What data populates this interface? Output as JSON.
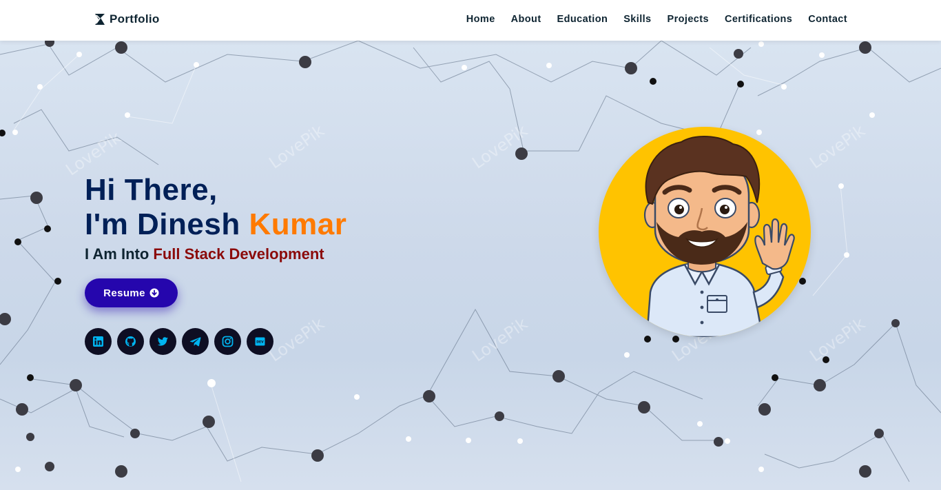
{
  "navbar": {
    "brand": "Portfolio",
    "links": [
      "Home",
      "About",
      "Education",
      "Skills",
      "Projects",
      "Certifications",
      "Contact"
    ]
  },
  "hero": {
    "greeting_line1": "Hi There,",
    "greeting_line2_prefix": "I'm Dinesh ",
    "greeting_line2_accent": "Kumar",
    "tagline_prefix": "I Am Into ",
    "tagline_role": "Full Stack Development",
    "resume_label": "Resume",
    "watermark": "LovePik",
    "socials": [
      {
        "name": "linkedin-icon"
      },
      {
        "name": "github-icon"
      },
      {
        "name": "twitter-icon"
      },
      {
        "name": "telegram-icon"
      },
      {
        "name": "instagram-icon"
      },
      {
        "name": "dev-icon",
        "label": "DEV"
      }
    ]
  },
  "colors": {
    "navy": "#002057",
    "accent_orange": "#ff7a00",
    "role_red": "#8b0a0a",
    "button_blue": "#2506ad",
    "social_bg": "#0e0e23",
    "social_icon": "#00b4f0",
    "avatar_bg": "#ffc300"
  }
}
